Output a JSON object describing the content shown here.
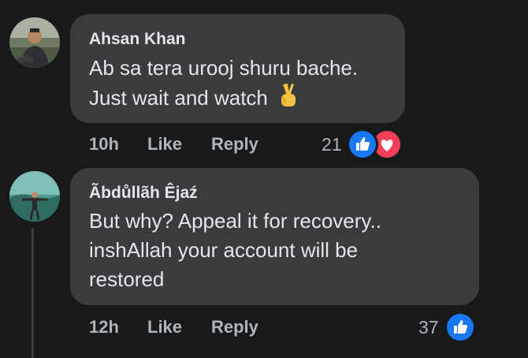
{
  "comments": [
    {
      "author": "Ahsan Khan",
      "lines": [
        "Ab sa tera urooj shuru bache.",
        "Just wait and watch"
      ],
      "time": "10h",
      "like_label": "Like",
      "reply_label": "Reply",
      "reaction_count": "21",
      "reactions": [
        "like-icon",
        "love-icon"
      ]
    },
    {
      "author": "Ãbdůllãh Êjaź",
      "lines": [
        "But why? Appeal it for recovery..",
        "inshAllah your account will be",
        "restored"
      ],
      "time": "12h",
      "like_label": "Like",
      "reply_label": "Reply",
      "reaction_count": "37",
      "reactions": [
        "like-icon"
      ]
    }
  ],
  "colors": {
    "background": "#18191a",
    "bubble": "#3a3b3c",
    "text": "#e4e6eb",
    "secondary_text": "#b0b3b8",
    "like_blue": "#1877f2",
    "love_red": "#f33e58"
  }
}
